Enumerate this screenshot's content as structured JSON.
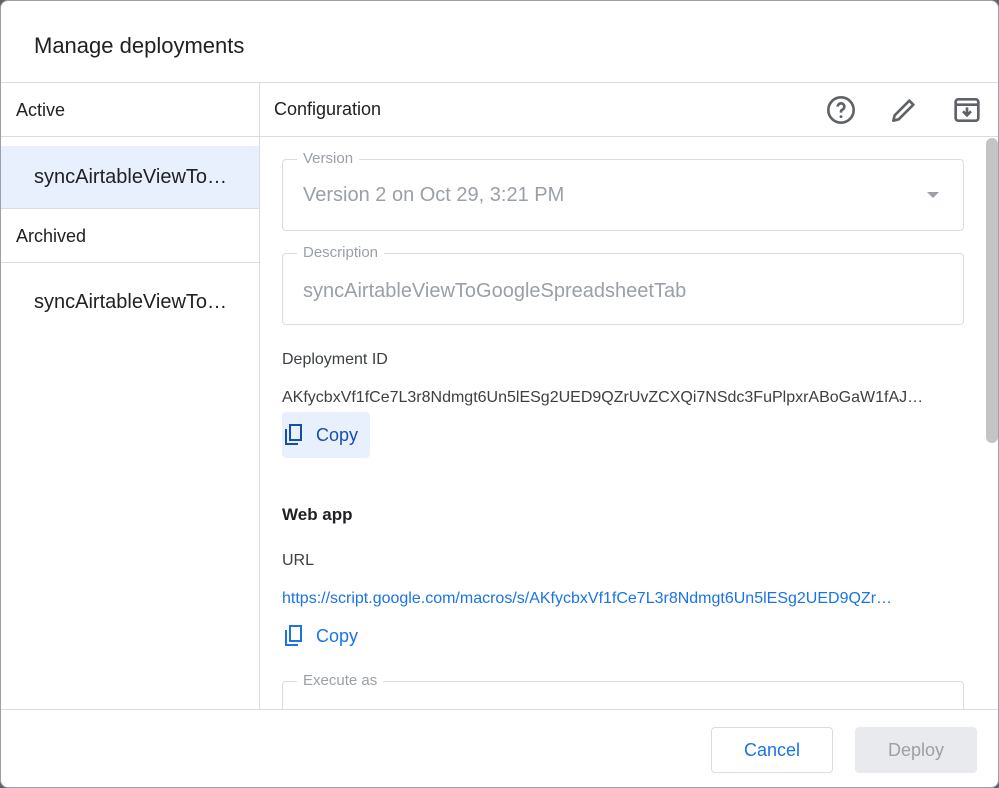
{
  "dialog": {
    "title": "Manage deployments"
  },
  "sidebar": {
    "active_header": "Active",
    "active_items": [
      "syncAirtableViewTo…"
    ],
    "archived_header": "Archived",
    "archived_items": [
      "syncAirtableViewTo…"
    ]
  },
  "config": {
    "header": "Configuration",
    "icons": [
      "help-circle-icon",
      "pencil-icon",
      "archive-icon"
    ],
    "version": {
      "label": "Version",
      "value": "Version 2 on Oct 29, 3:21 PM"
    },
    "description": {
      "label": "Description",
      "value": "syncAirtableViewToGoogleSpreadsheetTab"
    },
    "deployment_id": {
      "label": "Deployment ID",
      "value": "AKfycbxVf1fCe7L3r8Ndmgt6Un5lESg2UED9QZrUvZCXQi7NSdc3FuPlpxrABoGaW1fAJ…",
      "copy_label": "Copy"
    },
    "web_app": {
      "header": "Web app",
      "url_label": "URL",
      "url": "https://script.google.com/macros/s/AKfycbxVf1fCe7L3r8Ndmgt6Un5lESg2UED9QZr…",
      "copy_label": "Copy"
    },
    "execute_as": {
      "label": "Execute as"
    }
  },
  "footer": {
    "cancel": "Cancel",
    "deploy": "Deploy"
  },
  "colors": {
    "accent": "#1a73e8",
    "selected_bg": "#e8f0fe"
  }
}
